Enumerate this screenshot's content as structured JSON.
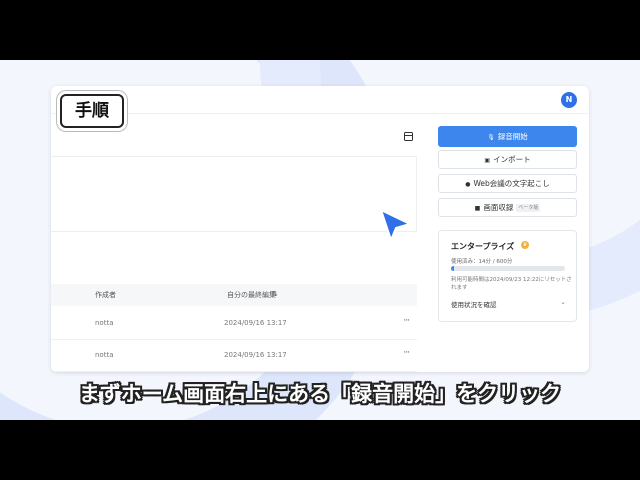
{
  "overlay": {
    "step_label": "手順",
    "caption": "まずホーム画面右上にある「録音開始」をクリック"
  },
  "header": {
    "avatar_initial": "N"
  },
  "actions": {
    "record_label": "録音開始",
    "import_label": "インポート",
    "web_meeting_label": "Web会議の文字起こし",
    "screen_record_label": "画面収録",
    "screen_record_badge": "ベータ版"
  },
  "plan": {
    "title": "エンタープライズ",
    "usage_text": "使用済み：14分 / 600分",
    "usage_fraction": 0.0233,
    "reset_text": "利用可能時間は2024/09/23 12:22にリセットされます",
    "details_link": "使用状況を確認"
  },
  "table": {
    "headers": {
      "creator": "作成者",
      "last_edited": "自分の最終編集"
    },
    "rows": [
      {
        "creator": "notta",
        "edited": "2024/09/16 13:17"
      },
      {
        "creator": "notta",
        "edited": "2024/09/16 13:17"
      }
    ]
  },
  "colors": {
    "accent": "#3c86ee",
    "cursor": "#2f6fe8"
  }
}
